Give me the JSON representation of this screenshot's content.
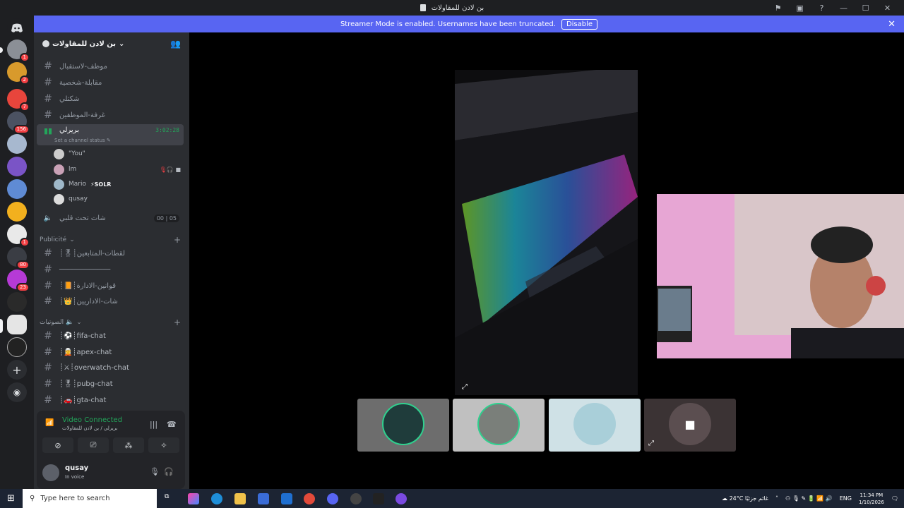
{
  "window": {
    "title": "بن لادن للمقاولات",
    "controls": {
      "flag": "⚑",
      "display": "▣",
      "help": "?",
      "minimize": "—",
      "maximize": "☐",
      "close": "✕"
    }
  },
  "banner": {
    "text": "Streamer Mode is enabled. Usernames have been truncated.",
    "disable_label": "Disable",
    "close_label": "✕",
    "color": "#5865f2"
  },
  "guilds": [
    {
      "badge": "1"
    },
    {
      "badge": "2"
    },
    {
      "badge": "7"
    },
    {
      "badge": "156"
    },
    {
      "badge": ""
    },
    {
      "badge": ""
    },
    {
      "badge": ""
    },
    {
      "badge": ""
    },
    {
      "badge": "1"
    },
    {
      "badge": "80"
    },
    {
      "badge": "23"
    },
    {
      "badge": ""
    },
    {
      "badge": ""
    },
    {
      "badge": ""
    }
  ],
  "server": {
    "name": "بن لادن للمقاولات",
    "chevron": "⌄",
    "add_member_icon": "person-add-icon"
  },
  "channels_top": [
    {
      "name": "موظف-لاستقبال"
    },
    {
      "name": "مقابلة-شخصية"
    },
    {
      "name": "شكتلي"
    },
    {
      "name": "غرفة-الموظفين"
    }
  ],
  "active_voice": {
    "name": "بريرلي",
    "timer": "3:02:28",
    "status_placeholder": "Set a channel status",
    "users": [
      {
        "name": "\"You\"",
        "tag": ""
      },
      {
        "name": "lm",
        "tag": ""
      },
      {
        "name": "Mario",
        "tag": "SOLR"
      },
      {
        "name": "qusay",
        "tag": ""
      }
    ]
  },
  "voice_two": {
    "name": "شات تحت قلبي",
    "count_left": "00",
    "count_right": "05"
  },
  "category_pub": {
    "name": "Publicité"
  },
  "pub_channels": [
    {
      "name": "┊🎖┊لقطات-المتابعين"
    },
    {
      "name": "────────────"
    },
    {
      "name": "┊📙┊قوانين-الادارة"
    },
    {
      "name": "┊👑┊شات-الاداريين"
    }
  ],
  "category_voice": {
    "name": "الصوتيات 🔈"
  },
  "voice_channels": [
    {
      "name": "┊⚽┊fifa-chat"
    },
    {
      "name": "┊🧝┊apex-chat"
    },
    {
      "name": "┊⚔┊overwatch-chat"
    },
    {
      "name": "┊🎖┊pubg-chat"
    },
    {
      "name": "┊🚗┊gta-chat"
    }
  ],
  "voice_panel": {
    "title": "Video Connected",
    "subtitle": "بريرلي / بن لادن للمقاولات",
    "user_name": "qusay",
    "user_status": "In voice"
  },
  "taskbar": {
    "search_placeholder": "Type here to search",
    "weather": "24°C غائم جزئيًا",
    "lang": "ENG",
    "time": "11:34 PM",
    "date": "1/10/2026"
  }
}
